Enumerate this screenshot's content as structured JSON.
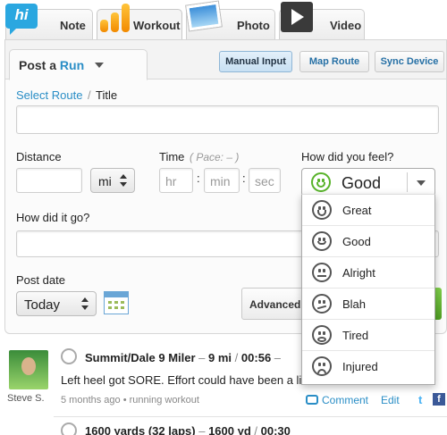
{
  "top_tabs": {
    "note": "Note",
    "workout": "Workout",
    "photo": "Photo",
    "video": "Video",
    "logo_text": "hi"
  },
  "post_tab": {
    "prefix": "Post a",
    "activity": "Run"
  },
  "entry_modes": {
    "manual": "Manual Input",
    "map": "Map Route",
    "sync": "Sync Device",
    "selected": "Manual Input"
  },
  "form": {
    "select_route": "Select Route",
    "route_sep": "/",
    "title_label": "Title",
    "distance_label": "Distance",
    "distance_unit": "mi",
    "time_label": "Time",
    "pace_label": "( Pace:   –   )",
    "hr_placeholder": "hr",
    "min_placeholder": "min",
    "sec_placeholder": "sec",
    "time_sep": ":",
    "feel_label": "How did you feel?",
    "feel_value": "Good",
    "how_label": "How did it go?",
    "post_date_label": "Post date",
    "post_date_value": "Today",
    "advanced_label": "Advanced"
  },
  "feel_options": [
    {
      "label": "Great",
      "icon": "grin-face-icon"
    },
    {
      "label": "Good",
      "icon": "smile-face-icon"
    },
    {
      "label": "Alright",
      "icon": "neutral-face-icon"
    },
    {
      "label": "Blah",
      "icon": "meh-face-icon"
    },
    {
      "label": "Tired",
      "icon": "tired-face-icon"
    },
    {
      "label": "Injured",
      "icon": "injured-face-icon"
    }
  ],
  "feed": [
    {
      "title": "Summit/Dale 9 Miler",
      "distance": "9 mi",
      "sep1": "–",
      "sep2": "/",
      "time": "00:56",
      "extra": "–",
      "body": "Left heel got SORE. Effort could have been a li",
      "meta": "5 months ago • running workout",
      "user": "Steve S.",
      "comment": "Comment",
      "edit": "Edit"
    },
    {
      "title": "1600 yards (32 laps)",
      "distance": "1600 yd",
      "sep1": "–",
      "sep2": "/",
      "time": "00:30"
    }
  ],
  "colors": {
    "accent": "#2a8ec6",
    "good_green": "#58b32a",
    "facebook": "#3b5998"
  }
}
